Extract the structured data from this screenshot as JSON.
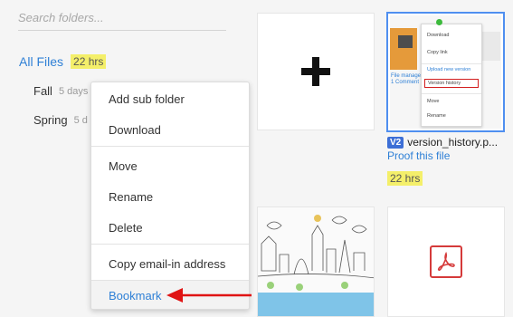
{
  "search": {
    "placeholder": "Search folders..."
  },
  "folders": {
    "all": {
      "name": "All Files",
      "age": "22 hrs"
    },
    "children": [
      {
        "name": "Fall",
        "age": "5 days"
      },
      {
        "name": "Spring",
        "age": "5 d"
      }
    ]
  },
  "context_menu": {
    "items": [
      {
        "label": "Add sub folder"
      },
      {
        "label": "Download"
      },
      {
        "label": "Move"
      },
      {
        "label": "Rename"
      },
      {
        "label": "Delete"
      },
      {
        "label": "Copy email-in address"
      },
      {
        "label": "Bookmark"
      }
    ]
  },
  "tiles": {
    "add_icon": "plus-icon",
    "version_file": {
      "badge": "V2",
      "name": "version_history.p...",
      "link": "Proof this file",
      "age": "22 hrs",
      "thumbnail": {
        "caption_lines": [
          "File manage",
          "1 Comment"
        ],
        "menu_items": [
          "Download",
          "Copy link",
          "Upload new version",
          "Version history",
          "Move",
          "Rename"
        ]
      }
    },
    "pdf_icon": "pdf-icon"
  },
  "colors": {
    "accent": "#2f80d6",
    "highlight": "#f4ef6a",
    "selected_border": "#4f8ff0",
    "arrow": "#e01414",
    "pdf": "#d53a3a"
  }
}
